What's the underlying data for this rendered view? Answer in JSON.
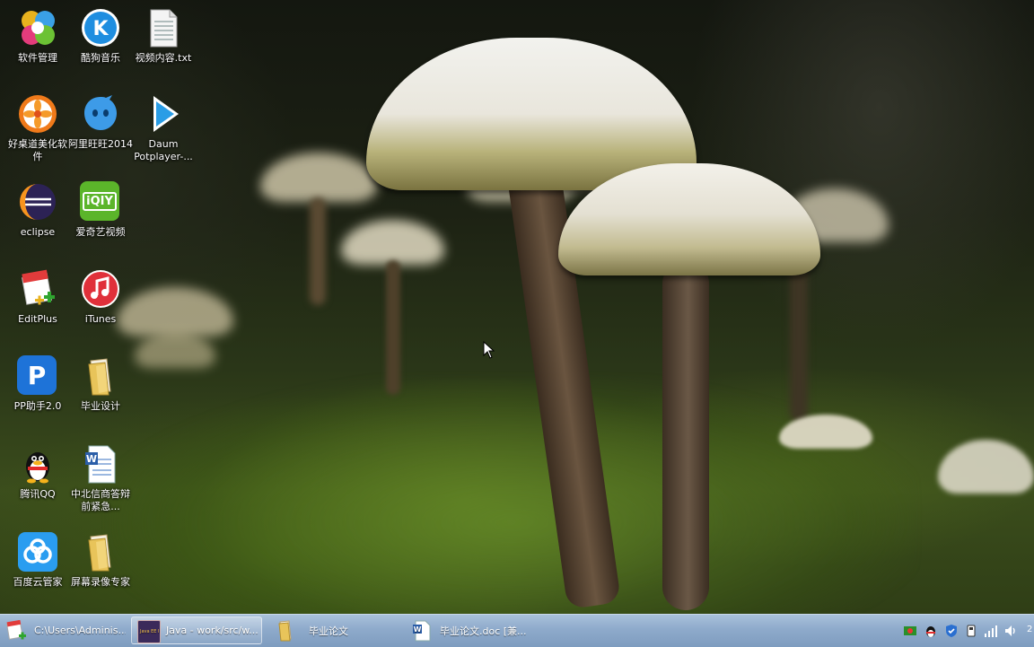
{
  "desktop": {
    "icons": [
      {
        "label": "软件管理",
        "icon": "pinwheel-icon"
      },
      {
        "label": "酷狗音乐",
        "icon": "kugou-k-icon"
      },
      {
        "label": "视频内容.txt",
        "icon": "text-file-icon"
      },
      {
        "label": "好桌道美化软件",
        "icon": "orange-flower-icon"
      },
      {
        "label": "阿里旺旺2014",
        "icon": "wangwang-icon"
      },
      {
        "label": "Daum Potplayer-...",
        "icon": "play-icon"
      },
      {
        "label": "eclipse",
        "icon": "eclipse-icon"
      },
      {
        "label": "爱奇艺视频",
        "icon": "iqiyi-icon"
      },
      {
        "label": "EditPlus",
        "icon": "editplus-icon"
      },
      {
        "label": "iTunes",
        "icon": "itunes-icon"
      },
      {
        "label": "PP助手2.0",
        "icon": "pp-icon"
      },
      {
        "label": "毕业设计",
        "icon": "folder-icon"
      },
      {
        "label": "腾讯QQ",
        "icon": "qq-penguin-icon"
      },
      {
        "label": "中北信商答辩前紧急...",
        "icon": "word-doc-icon"
      },
      {
        "label": "百度云管家",
        "icon": "baidu-cloud-icon"
      },
      {
        "label": "屏幕录像专家",
        "icon": "folder-icon"
      }
    ],
    "iqiyi_text": "iQIY",
    "pp_text": "P"
  },
  "taskbar": {
    "buttons": [
      {
        "label": "C:\\Users\\Adminis...",
        "icon": "editplus-icon",
        "active": false
      },
      {
        "label": "Java - work/src/w...",
        "icon": "java-ee-ide-icon",
        "active": true
      },
      {
        "label": "毕业论文",
        "icon": "folder-icon",
        "active": false
      },
      {
        "label": "毕业论文.doc [兼...",
        "icon": "word-doc-icon",
        "active": false
      }
    ],
    "ide_badge": "Java EE IDE",
    "clock_fragment": "2"
  },
  "colors": {
    "taskbar": "#8eaacb",
    "folder": "#e8c45a",
    "itunes": "#e0303a",
    "iqiyi": "#5bb52a",
    "pp": "#1e73d8"
  }
}
